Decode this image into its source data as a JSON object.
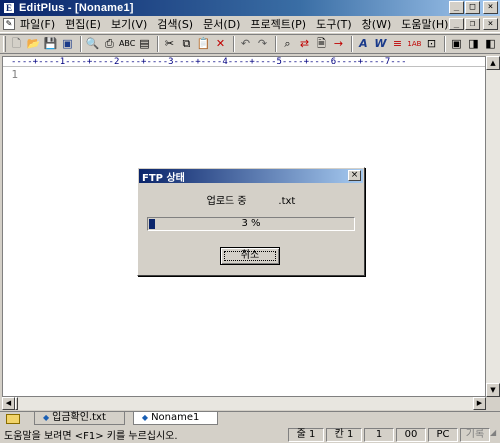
{
  "window": {
    "title": "EditPlus - [Noname1]"
  },
  "menu": [
    "파일(F)",
    "편집(E)",
    "보기(V)",
    "검색(S)",
    "문서(D)",
    "프로젝트(P)",
    "도구(T)",
    "창(W)",
    "도움말(H)"
  ],
  "toolbar_icons": [
    "new-icon",
    "open-icon",
    "save-icon",
    "save-all-icon",
    "print-preview-icon",
    "print-icon",
    "spell-check-icon",
    "browser-icon",
    "cut-icon",
    "copy-icon",
    "paste-icon",
    "delete-icon",
    "undo-icon",
    "redo-icon",
    "find-icon",
    "replace-icon",
    "find-in-files-icon",
    "goto-icon",
    "font-icon",
    "word-wrap-icon",
    "line-number-icon",
    "ruler-icon",
    "fullscreen-icon",
    "window-1-icon",
    "window-2-icon",
    "window-3-icon"
  ],
  "editor": {
    "ruler": "----+----1----+----2----+----3----+----4----+----5----+----6----+----7---",
    "line_number": "1"
  },
  "dialog": {
    "title": "FTP 상태",
    "message": "업로드 중          .txt",
    "progress_label": "3 %",
    "progress_fraction": 0.03,
    "cancel_label": "취소"
  },
  "tabs": [
    {
      "label": "입금확인.txt",
      "active": false
    },
    {
      "label": "Noname1",
      "active": true
    }
  ],
  "status": {
    "help": "도움말을 보려면 <F1> 키를 누르십시오.",
    "line": "줄 1",
    "col": "칸 1",
    "sel": "1",
    "ins": "00",
    "mode": "PC",
    "rec": "기록"
  },
  "colors": {
    "title_active": "#0a246a",
    "progress": "#0a246a"
  }
}
